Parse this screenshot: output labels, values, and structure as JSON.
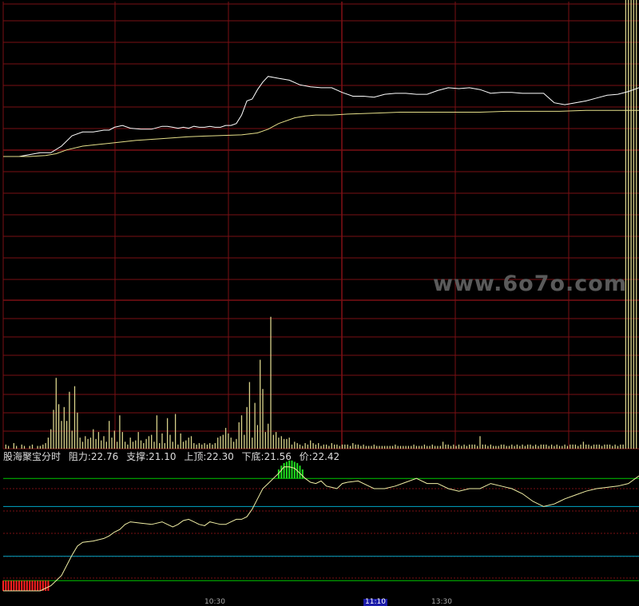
{
  "colors": {
    "background": "#000000",
    "grid": "#7a0f14",
    "price_line": "#ffffff",
    "avg_line": "#e6e08a",
    "volume_bar": "#d8d28a",
    "indicator_line": "#f2f0a6",
    "green_band": "#00c800",
    "blue_band": "#00a8c8",
    "red_bar": "#ff2020",
    "green_bar": "#20e020",
    "label_text": "#dddddd"
  },
  "indicator_labels": {
    "name": "股海聚宝分时",
    "resistance": "阻力:22.76",
    "support": "支撑:21.10",
    "top": "上顶:22.30",
    "bottom": "下底:21.56",
    "price": "价:22.42"
  },
  "watermark": "www.6o7o.com",
  "time_labels": [
    "10:30",
    "11:10",
    "13:30"
  ],
  "chart_data": [
    {
      "type": "line",
      "panel": "intraday price",
      "ylim": [
        0,
        100
      ],
      "x_range": [
        0,
        240
      ],
      "grid": true,
      "series": [
        {
          "role": "price",
          "x": [
            0,
            6,
            10,
            14,
            18,
            22,
            26,
            30,
            34,
            38,
            40,
            42,
            45,
            48,
            52,
            56,
            60,
            62,
            64,
            66,
            68,
            70,
            72,
            74,
            76,
            78,
            80,
            82,
            84,
            86,
            88,
            90,
            92,
            94,
            96,
            98,
            100,
            104,
            108,
            112,
            116,
            120,
            124,
            128,
            132,
            136,
            140,
            144,
            148,
            152,
            156,
            160,
            164,
            168,
            172,
            176,
            180,
            184,
            188,
            192,
            196,
            200,
            204,
            208,
            212,
            216,
            220,
            224,
            228,
            232,
            236,
            240
          ],
          "y": [
            61,
            61,
            63,
            65,
            65,
            72,
            83,
            87,
            87,
            89,
            89,
            92,
            94,
            91,
            90,
            90,
            93,
            93,
            92,
            91,
            92,
            91,
            93,
            92,
            92,
            93,
            92,
            92,
            94,
            94,
            96,
            105,
            120,
            122,
            132,
            140,
            146,
            144,
            142,
            137,
            135,
            134,
            134,
            129,
            125,
            125,
            124,
            127,
            128,
            128,
            127,
            127,
            131,
            134,
            133,
            134,
            132,
            128,
            129,
            129,
            128,
            128,
            128,
            118,
            116,
            118,
            120,
            123,
            126,
            127,
            130,
            134
          ]
        },
        {
          "role": "average",
          "x": [
            0,
            10,
            16,
            20,
            24,
            30,
            40,
            50,
            60,
            70,
            80,
            90,
            96,
            100,
            104,
            110,
            114,
            118,
            124,
            130,
            140,
            150,
            160,
            170,
            180,
            190,
            200,
            210,
            220,
            230,
            240
          ],
          "y": [
            61,
            61,
            62,
            64,
            68,
            72,
            75,
            78,
            80,
            82,
            83,
            84,
            86,
            90,
            96,
            102,
            104,
            105,
            105,
            106,
            107,
            108,
            108,
            108,
            108,
            109,
            109,
            109,
            110,
            110,
            110
          ]
        }
      ]
    },
    {
      "type": "bar",
      "panel": "volume",
      "ylim": [
        0,
        100
      ],
      "x": [
        1,
        2,
        4,
        5,
        7,
        8,
        10,
        11,
        13,
        14,
        15,
        16,
        17,
        18,
        19,
        20,
        21,
        22,
        23,
        24,
        25,
        26,
        27,
        28,
        29,
        30,
        31,
        32,
        33,
        34,
        35,
        36,
        37,
        38,
        39,
        40,
        41,
        42,
        43,
        44,
        45,
        46,
        47,
        48,
        49,
        50,
        51,
        52,
        53,
        54,
        55,
        56,
        57,
        58,
        59,
        60,
        61,
        62,
        63,
        64,
        65,
        66,
        67,
        68,
        69,
        70,
        71,
        72,
        73,
        74,
        75,
        76,
        77,
        78,
        79,
        80,
        81,
        82,
        83,
        84,
        85,
        86,
        87,
        88,
        89,
        90,
        91,
        92,
        93,
        94,
        95,
        96,
        97,
        98,
        99,
        100,
        101,
        102,
        103,
        104,
        105,
        106,
        107,
        108,
        109,
        110,
        111,
        112,
        113,
        114,
        115,
        116,
        117,
        118,
        119,
        120,
        121,
        122,
        123,
        124,
        125,
        126,
        127,
        128,
        129,
        130,
        131,
        132,
        133,
        134,
        135,
        136,
        137,
        138,
        139,
        140,
        141,
        142,
        143,
        144,
        145,
        146,
        147,
        148,
        149,
        150,
        151,
        152,
        153,
        154,
        155,
        156,
        157,
        158,
        159,
        160,
        161,
        162,
        163,
        164,
        165,
        166,
        167,
        168,
        169,
        170,
        171,
        172,
        173,
        174,
        175,
        176,
        177,
        178,
        179,
        180,
        181,
        182,
        183,
        184,
        185,
        186,
        187,
        188,
        189,
        190,
        191,
        192,
        193,
        194,
        195,
        196,
        197,
        198,
        199,
        200,
        201,
        202,
        203,
        204,
        205,
        206,
        207,
        208,
        209,
        210,
        211,
        212,
        213,
        214,
        215,
        216,
        217,
        218,
        219,
        220,
        221,
        222,
        223,
        224,
        225,
        226,
        227,
        228,
        229,
        230,
        231,
        232,
        233,
        234,
        235,
        236,
        237,
        238,
        239
      ],
      "values": [
        3,
        2,
        4,
        2,
        3,
        2,
        2,
        3,
        2,
        2,
        3,
        4,
        8,
        14,
        28,
        51,
        32,
        20,
        30,
        20,
        41,
        13,
        45,
        26,
        8,
        5,
        9,
        7,
        8,
        14,
        7,
        12,
        6,
        9,
        5,
        20,
        8,
        13,
        5,
        24,
        12,
        5,
        3,
        8,
        5,
        6,
        12,
        6,
        4,
        7,
        9,
        10,
        5,
        24,
        4,
        11,
        4,
        22,
        10,
        5,
        25,
        3,
        11,
        5,
        6,
        8,
        9,
        4,
        3,
        4,
        3,
        4,
        3,
        4,
        3,
        4,
        8,
        9,
        10,
        15,
        11,
        8,
        5,
        7,
        19,
        24,
        10,
        30,
        48,
        8,
        33,
        17,
        64,
        43,
        12,
        18,
        95,
        10,
        12,
        8,
        9,
        7,
        7,
        8,
        3,
        5,
        4,
        3,
        2,
        4,
        3,
        6,
        4,
        3,
        4,
        2,
        3,
        3,
        2,
        4,
        3,
        3,
        2,
        3,
        3,
        3,
        2,
        4,
        3,
        3,
        2,
        3,
        2,
        2,
        2,
        3,
        2,
        2,
        2,
        2,
        2,
        2,
        2,
        3,
        2,
        2,
        2,
        2,
        2,
        2,
        3,
        2,
        2,
        2,
        3,
        2,
        2,
        3,
        2,
        2,
        2,
        5,
        3,
        3,
        2,
        3,
        2,
        3,
        2,
        3,
        2,
        3,
        3,
        3,
        2,
        9,
        3,
        3,
        2,
        3,
        2,
        2,
        2,
        3,
        3,
        2,
        2,
        3,
        2,
        3,
        2,
        3,
        2,
        3,
        3,
        2,
        3,
        2,
        3,
        3,
        3,
        2,
        3,
        2,
        3,
        2,
        2,
        3,
        2,
        3,
        3,
        3,
        2,
        3,
        5,
        3,
        3,
        2,
        3,
        3,
        3,
        2,
        3,
        3,
        3,
        2,
        3,
        2,
        3,
        3
      ]
    },
    {
      "type": "line",
      "panel": "indicator",
      "ylim": [
        0,
        100
      ],
      "x_range": [
        0,
        240
      ],
      "reference_lines": [
        {
          "value": 88,
          "color": "#00c800"
        },
        {
          "value": 66,
          "color": "#00a8c8"
        },
        {
          "value": 27,
          "color": "#00a8c8"
        },
        {
          "value": 8,
          "color": "#00c800"
        }
      ],
      "series": [
        {
          "role": "indicator",
          "x": [
            0,
            6,
            10,
            14,
            18,
            22,
            24,
            26,
            28,
            30,
            34,
            38,
            40,
            42,
            44,
            46,
            48,
            52,
            56,
            60,
            62,
            64,
            66,
            68,
            70,
            72,
            74,
            76,
            78,
            80,
            82,
            84,
            86,
            88,
            90,
            92,
            94,
            96,
            98,
            100,
            102,
            104,
            106,
            108,
            110,
            112,
            114,
            116,
            118,
            120,
            122,
            124,
            126,
            128,
            130,
            134,
            138,
            140,
            144,
            148,
            152,
            156,
            160,
            164,
            168,
            172,
            176,
            180,
            184,
            188,
            192,
            196,
            200,
            204,
            208,
            210,
            212,
            216,
            220,
            224,
            228,
            232,
            236,
            240
          ],
          "y": [
            0,
            0,
            0,
            0,
            4,
            12,
            20,
            28,
            35,
            38,
            39,
            41,
            43,
            46,
            48,
            52,
            54,
            53,
            52,
            54,
            52,
            50,
            52,
            55,
            56,
            54,
            52,
            51,
            54,
            53,
            52,
            52,
            54,
            56,
            56,
            58,
            64,
            72,
            80,
            84,
            88,
            92,
            97,
            97,
            96,
            92,
            88,
            85,
            84,
            86,
            82,
            81,
            80,
            84,
            85,
            86,
            82,
            80,
            80,
            82,
            85,
            88,
            84,
            84,
            80,
            78,
            80,
            80,
            84,
            82,
            80,
            76,
            70,
            66,
            68,
            70,
            72,
            75,
            78,
            80,
            81,
            82,
            84,
            90
          ]
        }
      ],
      "histogram": [
        {
          "color": "#ff2020",
          "x": [
            0,
            1,
            2,
            3,
            4,
            5,
            6,
            7,
            8,
            9,
            10,
            11,
            12,
            13,
            14,
            15,
            16,
            17
          ],
          "y": [
            8,
            8,
            8,
            8,
            8,
            8,
            8,
            8,
            8,
            8,
            8,
            8,
            8,
            8,
            8,
            8,
            8,
            8
          ],
          "base": 0
        },
        {
          "color": "#20e020",
          "x": [
            104,
            105,
            106,
            107,
            108,
            109,
            110,
            111,
            112,
            113
          ],
          "y": [
            95,
            98,
            100,
            101,
            102,
            102,
            101,
            100,
            98,
            95
          ],
          "base": 88
        }
      ]
    }
  ]
}
